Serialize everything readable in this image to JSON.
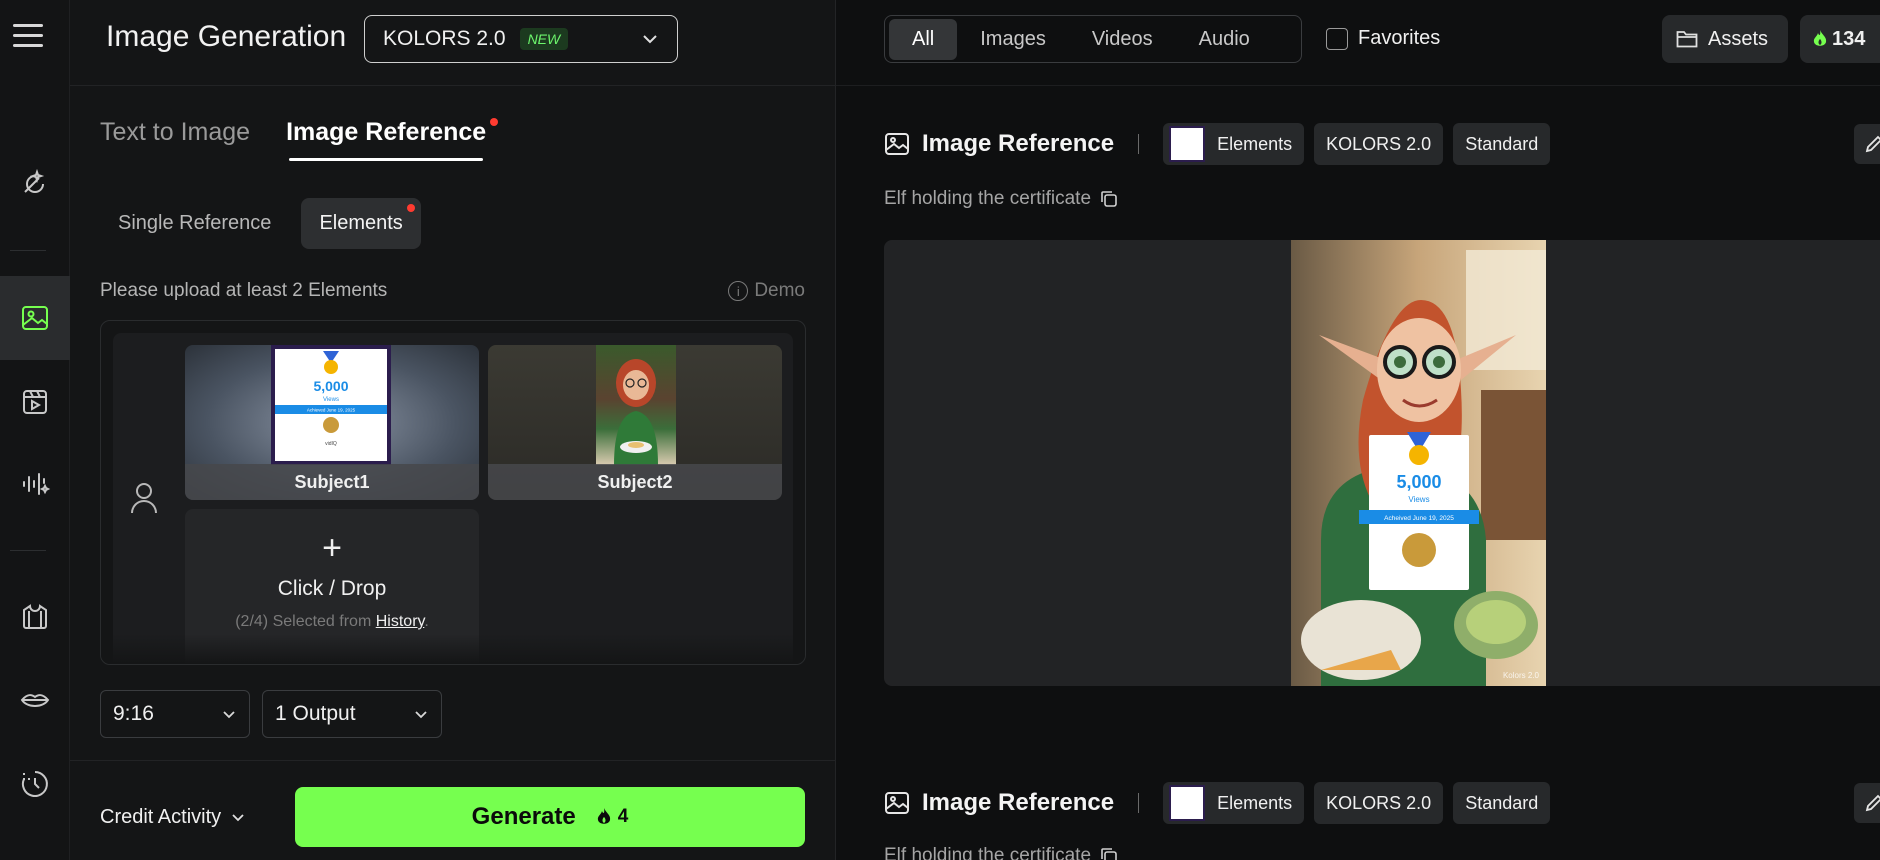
{
  "header": {
    "title": "Image Generation",
    "model": "KOLORS 2.0",
    "model_badge": "NEW"
  },
  "mode_tabs": [
    {
      "label": "Text to Image",
      "active": false
    },
    {
      "label": "Image Reference",
      "active": true
    }
  ],
  "ref_tabs": [
    {
      "label": "Single Reference",
      "active": false
    },
    {
      "label": "Elements",
      "active": true
    }
  ],
  "upload": {
    "hint": "Please upload at least 2 Elements",
    "demo": "Demo",
    "subjects": [
      {
        "label": "Subject1"
      },
      {
        "label": "Subject2"
      }
    ],
    "thumb_text": {
      "views_count": "5,000",
      "views_label": "Views",
      "achieved": "Achieved June 19, 2025",
      "brand": "vidIQ"
    },
    "add": {
      "plus": "+",
      "title": "Click / Drop",
      "selected_prefix": "(2/4) Selected from",
      "history_link": "History",
      "suffix": "."
    }
  },
  "options": {
    "ratio": "9:16",
    "outputs": "1 Output"
  },
  "footer": {
    "credit_activity": "Credit Activity",
    "generate": "Generate",
    "cost": "4"
  },
  "filters": [
    {
      "label": "All",
      "active": true
    },
    {
      "label": "Images",
      "active": false
    },
    {
      "label": "Videos",
      "active": false
    },
    {
      "label": "Audio",
      "active": false
    }
  ],
  "favorites": "Favorites",
  "assets": "Assets",
  "credits_balance": "134",
  "generations": [
    {
      "title": "Image Reference",
      "chips": [
        "Elements",
        "KOLORS 2.0",
        "Standard"
      ],
      "prompt": "Elf holding the certificate"
    },
    {
      "title": "Image Reference",
      "chips": [
        "Elements",
        "KOLORS 2.0",
        "Standard"
      ],
      "prompt": "Elf holding the certificate"
    }
  ],
  "result_image": {
    "cert_views": "5,000",
    "cert_views_label": "Views",
    "cert_achieved": "Acheived June 19, 2025",
    "watermark": "Kolors 2.0"
  },
  "colors": {
    "accent": "#76ff4f",
    "notify": "#ff3b30",
    "badge_text": "#6cf56c"
  }
}
